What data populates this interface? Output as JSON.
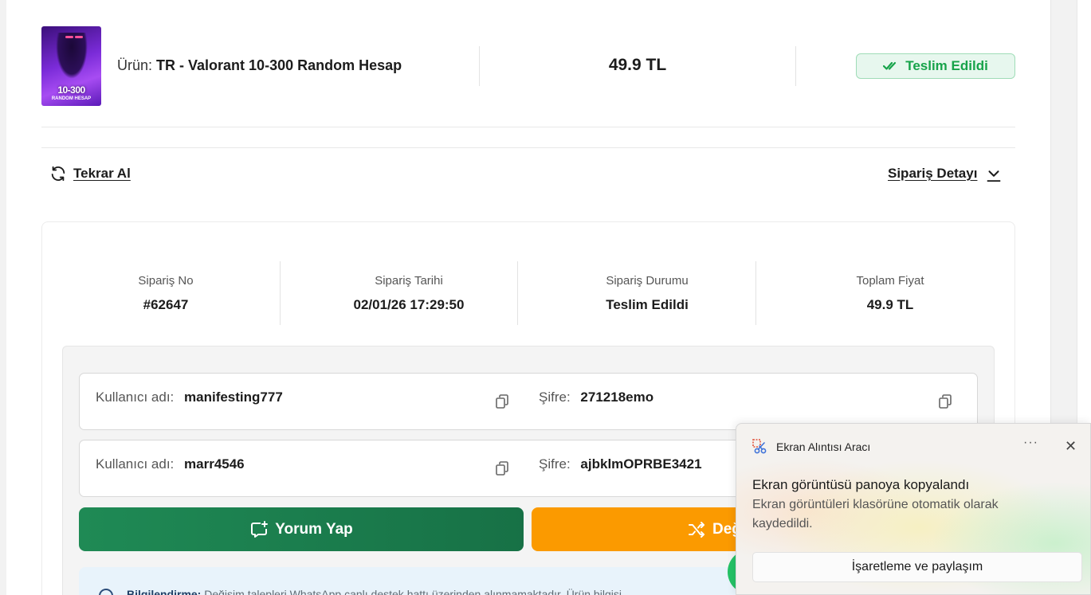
{
  "product": {
    "thumb_line1": "10-300",
    "thumb_line2": "RANDOM HESAP",
    "label_prefix": "Ürün:",
    "name": "TR - Valorant 10-300 Random Hesap",
    "price": "49.9 TL",
    "status": "Teslim Edildi"
  },
  "actions": {
    "reorder": "Tekrar Al",
    "order_detail": "Sipariş Detayı"
  },
  "order": {
    "stats": [
      {
        "label": "Sipariş No",
        "value": "#62647"
      },
      {
        "label": "Sipariş Tarihi",
        "value": "02/01/26 17:29:50"
      },
      {
        "label": "Sipariş Durumu",
        "value": "Teslim Edildi"
      },
      {
        "label": "Toplam Fiyat",
        "value": "49.9 TL"
      }
    ],
    "credentials": [
      {
        "user_label": "Kullanıcı adı:",
        "user": "manifesting777",
        "pass_label": "Şifre:",
        "pass": "271218emo"
      },
      {
        "user_label": "Kullanıcı adı:",
        "user": "marr4546",
        "pass_label": "Şifre:",
        "pass": "ajbklmOPRBE3421"
      }
    ],
    "comment_button": "Yorum Yap",
    "change_button": "Değ",
    "info_label": "Bilgilendirme:",
    "info_text": "Değişim talepleri WhatsApp canlı destek hattı üzerinden alınmamaktadır. Ürün bilgisi"
  },
  "toast": {
    "app_name": "Ekran Alıntısı Aracı",
    "more": "···",
    "close": "✕",
    "title": "Ekran görüntüsü panoya kopyalandı",
    "body": "Ekran görüntüleri klasörüne otomatik olarak kaydedildi.",
    "button": "İşaretleme ve paylaşım"
  },
  "colors": {
    "status_green": "#17a34a",
    "comment_green": "#1a7d4d",
    "change_orange": "#fb9a00",
    "info_bg": "#e8f3fb"
  }
}
